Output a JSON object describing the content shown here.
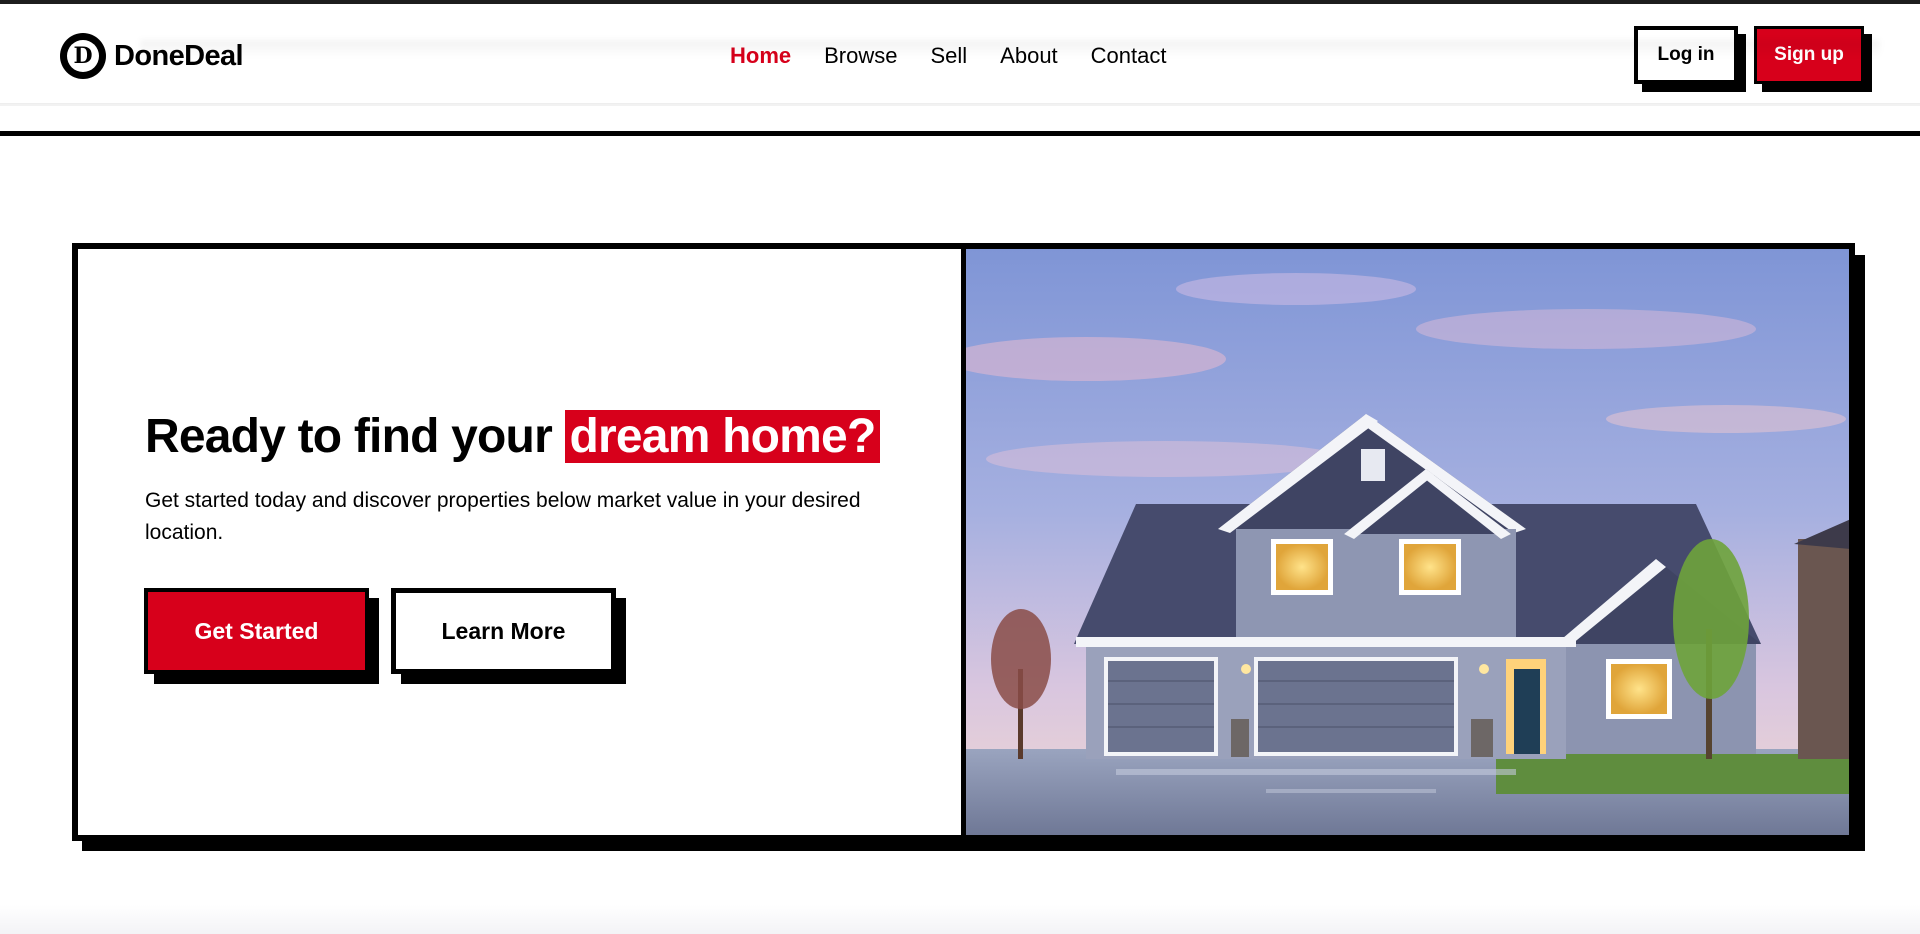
{
  "brand": {
    "name": "DoneDeal",
    "logo_letter": "D"
  },
  "nav": {
    "items": [
      {
        "label": "Home",
        "active": true
      },
      {
        "label": "Browse",
        "active": false
      },
      {
        "label": "Sell",
        "active": false
      },
      {
        "label": "About",
        "active": false
      },
      {
        "label": "Contact",
        "active": false
      }
    ]
  },
  "auth": {
    "login_label": "Log in",
    "signup_label": "Sign up"
  },
  "hero": {
    "title_prefix": "Ready to find your",
    "title_highlight": "dream home?",
    "subtitle": "Get started today and discover properties below market value in your desired location.",
    "primary_cta": "Get Started",
    "secondary_cta": "Learn More",
    "image_subject": "two-story suburban house at dusk"
  },
  "colors": {
    "accent": "#d7001b",
    "ink": "#000000",
    "background": "#ffffff"
  },
  "icons": {
    "logo": "circle-d-logo-icon"
  }
}
